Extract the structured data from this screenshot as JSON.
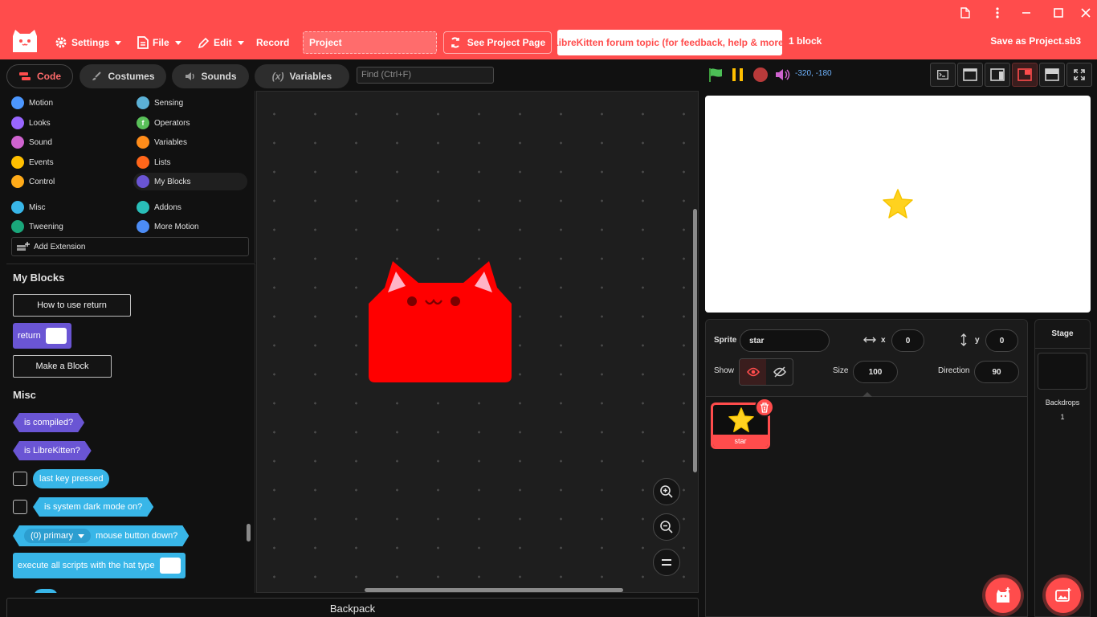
{
  "menu": {
    "settings": "Settings",
    "file": "File",
    "edit": "Edit",
    "record": "Record",
    "project_title": "Project",
    "see_project_page": "See Project Page",
    "forum_link": "LibreKitten forum topic (for feedback, help & more)",
    "block_count": "1 block",
    "save_as": "Save as Project.sb3"
  },
  "tabs": {
    "code": "Code",
    "costumes": "Costumes",
    "sounds": "Sounds",
    "variables": "Variables",
    "variables_icon_text": "(x)",
    "find_placeholder": "Find (Ctrl+F)"
  },
  "stage_controls": {
    "coords": "-320, -180"
  },
  "categories": [
    {
      "label": "Motion",
      "color": "#4c97ff"
    },
    {
      "label": "Sensing",
      "color": "#5cb1d6"
    },
    {
      "label": "Looks",
      "color": "#9966ff"
    },
    {
      "label": "Operators",
      "color": "#59c059"
    },
    {
      "label": "Sound",
      "color": "#cf63cf"
    },
    {
      "label": "Variables",
      "color": "#ff8c1a"
    },
    {
      "label": "Events",
      "color": "#ffbf00"
    },
    {
      "label": "Lists",
      "color": "#ff661a"
    },
    {
      "label": "Control",
      "color": "#ffab19"
    },
    {
      "label": "My Blocks",
      "color": "#6a55d4"
    },
    {
      "label": "Misc",
      "color": "#38b6e8"
    },
    {
      "label": "Addons",
      "color": "#29beb8"
    },
    {
      "label": "Tweening",
      "color": "#1aa77b"
    },
    {
      "label": "More Motion",
      "color": "#4c8cf5"
    }
  ],
  "add_extension": "Add Extension",
  "palette": {
    "my_blocks_heading": "My Blocks",
    "how_to_use_return": "How to use return",
    "return_block": "return",
    "make_a_block": "Make a Block",
    "misc_heading": "Misc",
    "is_compiled": "is compiled?",
    "is_librekitten": "is LibreKitten?",
    "last_key_pressed": "last key pressed",
    "is_dark_mode": "is system dark mode on?",
    "mouse_button_option": "(0) primary",
    "mouse_button_down": "mouse button down?",
    "execute_all_scripts": "execute all scripts with the hat type"
  },
  "backpack": "Backpack",
  "sprite_info": {
    "sprite_label": "Sprite",
    "sprite_name": "star",
    "x_label": "x",
    "x_value": "0",
    "y_label": "y",
    "y_value": "0",
    "show_label": "Show",
    "size_label": "Size",
    "size_value": "100",
    "direction_label": "Direction",
    "direction_value": "90"
  },
  "sprites": [
    {
      "name": "star"
    }
  ],
  "stage_pane": {
    "title": "Stage",
    "backdrops_label": "Backdrops",
    "backdrops_count": "1"
  },
  "colors": {
    "accent": "#ff4c4c",
    "background": "#111111",
    "workspace": "#1e1e1e",
    "star": "#ffd21f"
  }
}
